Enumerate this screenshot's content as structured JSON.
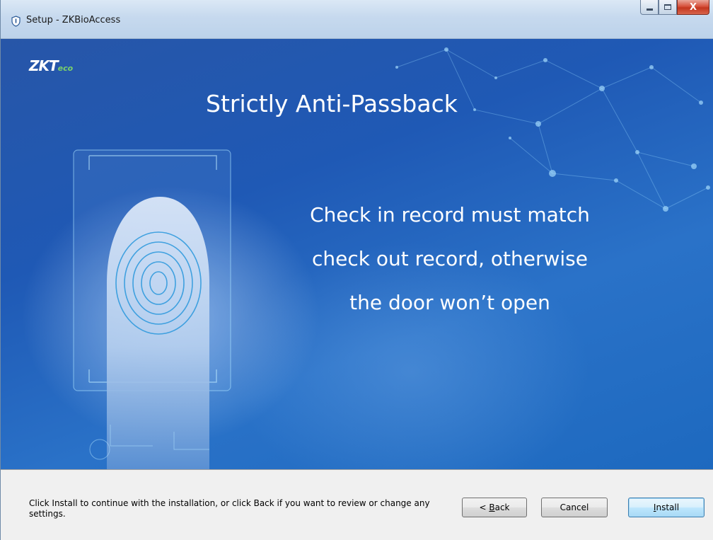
{
  "window": {
    "title": "Setup - ZKBioAccess",
    "controls": {
      "minimize_icon": "minimize-icon",
      "maximize_icon": "maximize-icon",
      "close_glyph": "X"
    }
  },
  "banner": {
    "logo_main": "ZKT",
    "logo_sub": "eco",
    "heading": "Strictly Anti-Passback",
    "description_lines": [
      "Check in record must match",
      "check out record, otherwise",
      "the door won’t open"
    ],
    "colors": {
      "background": "#1f59b5",
      "text": "#ffffff",
      "logo_accent": "#7bd16a"
    }
  },
  "footer": {
    "message": "Click Install to continue with the installation, or click Back if you want to review or change any settings.",
    "buttons": {
      "back": {
        "prefix": "< ",
        "accel": "B",
        "rest": "ack"
      },
      "cancel": {
        "label": "Cancel"
      },
      "install": {
        "accel": "I",
        "rest": "nstall"
      }
    }
  }
}
